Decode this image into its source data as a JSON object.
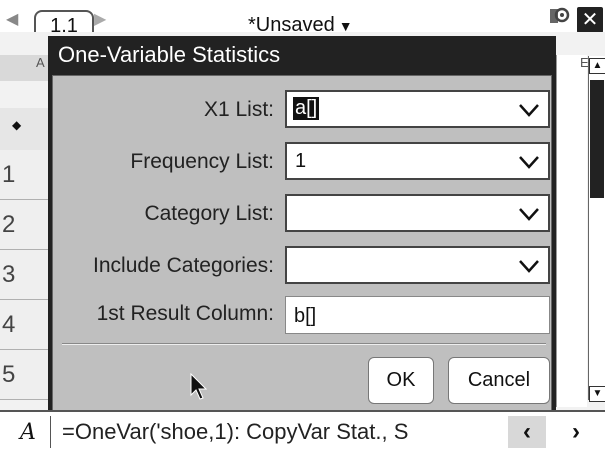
{
  "top_bar": {
    "nav_left": "◀",
    "tab_label": "1.1",
    "nav_right": "▶",
    "document_title": "*Unsaved",
    "title_arrow": "▼",
    "close_label": "✕"
  },
  "sheet": {
    "corner_col": "A",
    "right_col": "E",
    "diamond": "◆",
    "rows": [
      "1",
      "2",
      "3",
      "4",
      "5"
    ]
  },
  "dialog": {
    "title": "One-Variable Statistics",
    "fields": [
      {
        "label": "X1 List:",
        "value": "a[]",
        "kind": "dropdown"
      },
      {
        "label": "Frequency List:",
        "value": "1",
        "kind": "dropdown"
      },
      {
        "label": "Category List:",
        "value": "",
        "kind": "dropdown"
      },
      {
        "label": "Include Categories:",
        "value": "",
        "kind": "dropdown"
      },
      {
        "label": "1st Result Column:",
        "value": "b[]",
        "kind": "text"
      }
    ],
    "ok_label": "OK",
    "cancel_label": "Cancel"
  },
  "formula_bar": {
    "cell_ref": "A",
    "formula": "=OneVar('shoe,1): CopyVar Stat., S"
  },
  "icons": {
    "settings": "settings-icon",
    "chevron": "chevron-down-icon",
    "cursor": "mouse-pointer-icon"
  }
}
